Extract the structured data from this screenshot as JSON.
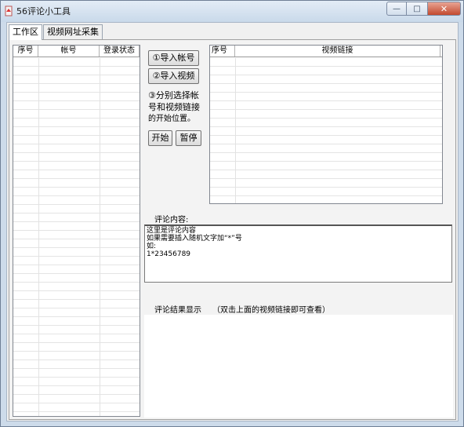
{
  "window": {
    "title": "56评论小工具"
  },
  "tabs": [
    {
      "label": "工作区",
      "active": true
    },
    {
      "label": "视频网址采集",
      "active": false
    }
  ],
  "accounts_list": {
    "columns": [
      "序号",
      "帐号",
      "登录状态"
    ]
  },
  "buttons": {
    "import_accounts": "①导入帐号",
    "import_videos": "②导入视频",
    "start": "开始",
    "pause": "暂停"
  },
  "instructions": {
    "line1": "③分别选择帐",
    "line2": "号和视频链接",
    "line3": "的开始位置。"
  },
  "videos_list": {
    "columns": [
      "序号",
      "视频链接"
    ]
  },
  "comment": {
    "label": "评论内容:",
    "content": "这里是评论内容\n如果需要插入随机文字加“*”号\n如:\n1*23456789"
  },
  "results": {
    "label": "评论结果显示",
    "hint": "（双击上面的视频链接即可查看）"
  },
  "colors": {
    "titlebar": "#cddbea",
    "close_button": "#c34a2f",
    "list_background": "#ffffff"
  }
}
